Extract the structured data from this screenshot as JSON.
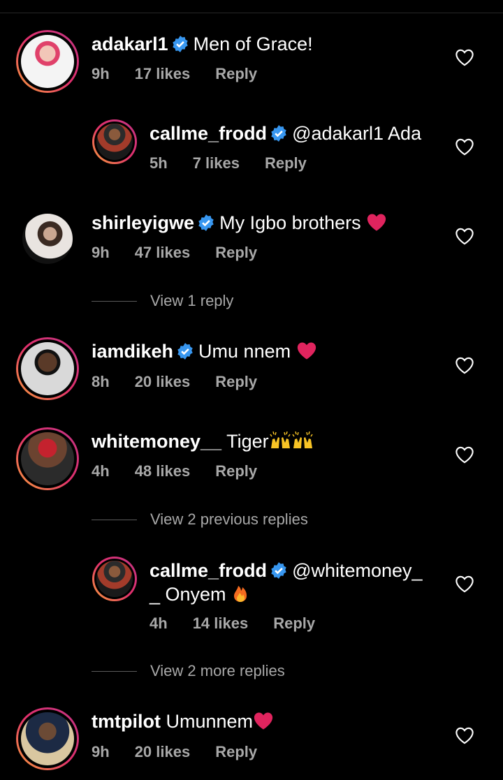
{
  "comments": [
    {
      "username": "adakarl1",
      "verified": true,
      "text": "Men of Grace!",
      "time": "9h",
      "likes": "17 likes",
      "reply": "Reply"
    },
    {
      "username": "callme_frodd",
      "verified": true,
      "text": "@adakarl1 Ada",
      "time": "5h",
      "likes": "7 likes",
      "reply": "Reply"
    },
    {
      "username": "shirleyigwe",
      "verified": true,
      "text": "My Igbo brothers",
      "time": "9h",
      "likes": "47 likes",
      "reply": "Reply",
      "emoji": "red-heart"
    },
    {
      "username": "iamdikeh",
      "verified": true,
      "text": "Umu nnem",
      "time": "8h",
      "likes": "20 likes",
      "reply": "Reply",
      "emoji": "red-heart"
    },
    {
      "username": "whitemoney__",
      "verified": false,
      "text": "Tiger",
      "time": "4h",
      "likes": "48 likes",
      "reply": "Reply",
      "emoji": "raising-hands"
    },
    {
      "username": "callme_frodd",
      "verified": true,
      "text": "@whitemoney_",
      "text2": "_ Onyem",
      "time": "4h",
      "likes": "14 likes",
      "reply": "Reply",
      "emoji": "fire"
    },
    {
      "username": "tmtpilot",
      "verified": false,
      "text": "Umunnem",
      "time": "9h",
      "likes": "20 likes",
      "reply": "Reply",
      "emoji": "red-heart"
    }
  ],
  "view_links": {
    "view_1_reply": "View 1 reply",
    "view_2_previous": "View 2 previous replies",
    "view_2_more": "View 2 more replies"
  },
  "colors": {
    "background": "#000000",
    "secondary_text": "#a8a8a8",
    "verified": "#3897f0",
    "heart_emoji": "#e0245e"
  }
}
